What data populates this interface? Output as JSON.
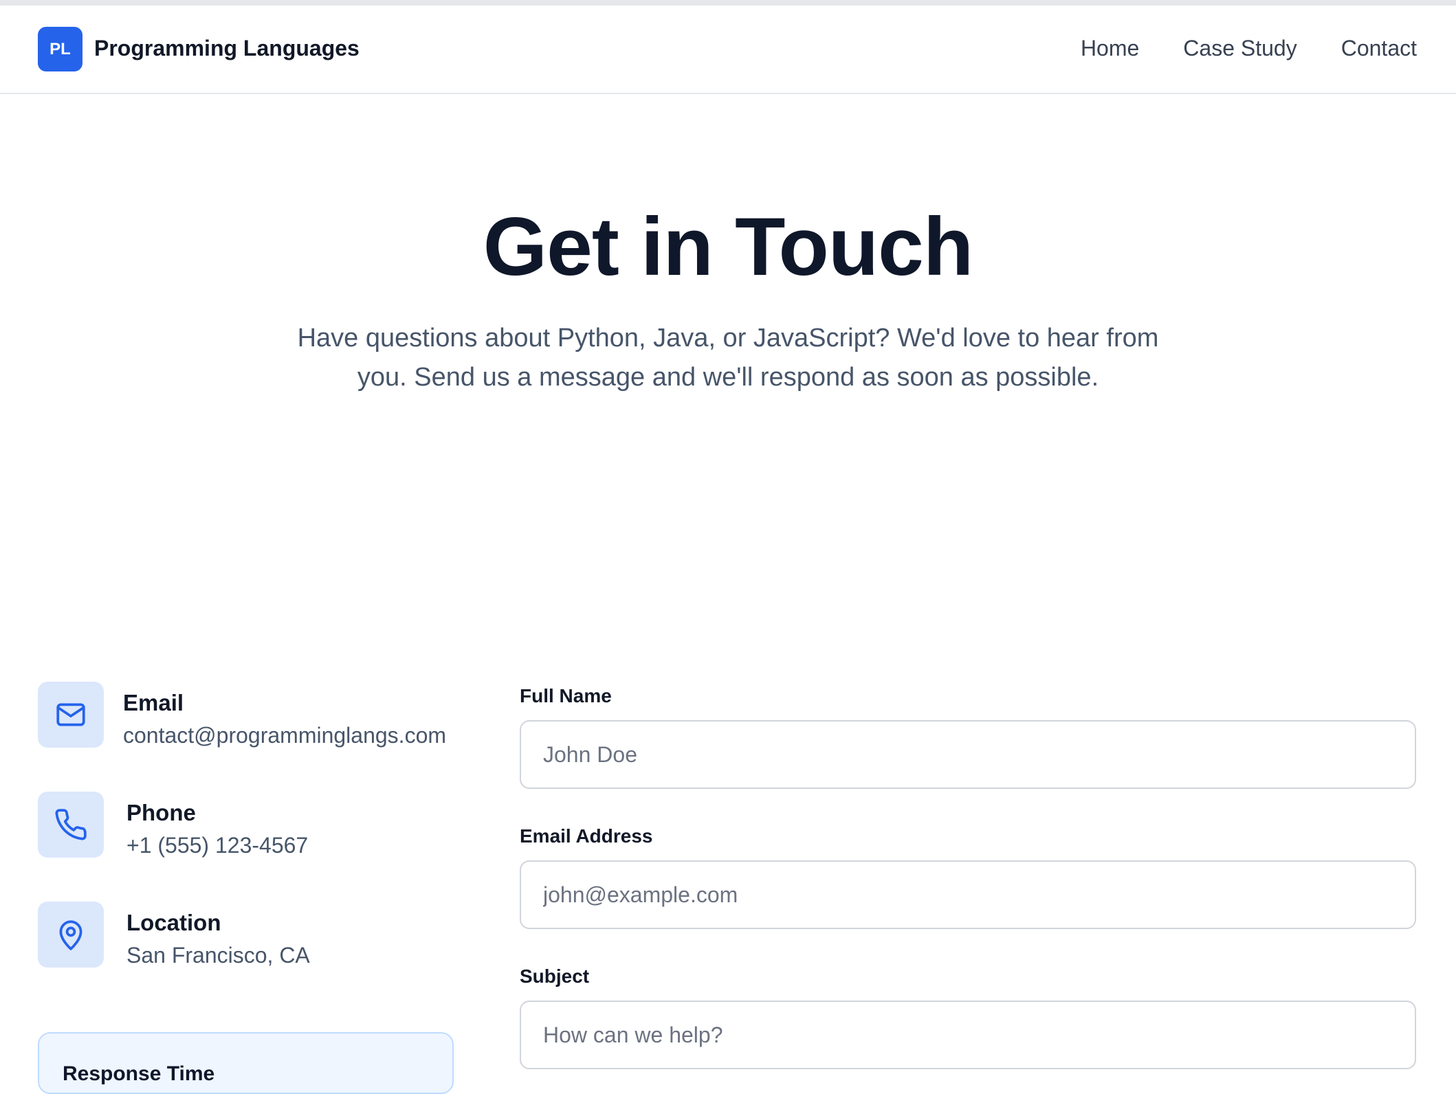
{
  "header": {
    "logo_text": "PL",
    "brand": "Programming Languages",
    "nav": [
      "Home",
      "Case Study",
      "Contact"
    ]
  },
  "hero": {
    "title": "Get in Touch",
    "subtitle_line1": "Have questions about Python, Java, or JavaScript? We'd love to hear from",
    "subtitle_line2": "you. Send us a message and we'll respond as soon as possible."
  },
  "contact": {
    "email": {
      "title": "Email",
      "value": "contact@programminglangs.com",
      "icon": "mail-icon"
    },
    "phone": {
      "title": "Phone",
      "value": "+1 (555) 123-4567",
      "icon": "phone-icon"
    },
    "location": {
      "title": "Location",
      "value": "San Francisco, CA",
      "icon": "map-pin-icon"
    },
    "response_card_title": "Response Time"
  },
  "form": {
    "name": {
      "label": "Full Name",
      "placeholder": "John Doe",
      "value": ""
    },
    "email": {
      "label": "Email Address",
      "placeholder": "john@example.com",
      "value": ""
    },
    "subject": {
      "label": "Subject",
      "placeholder": "How can we help?",
      "value": ""
    }
  },
  "colors": {
    "accent": "#2563eb",
    "icon_bg": "#dbe7fb",
    "text_muted": "#475569"
  }
}
